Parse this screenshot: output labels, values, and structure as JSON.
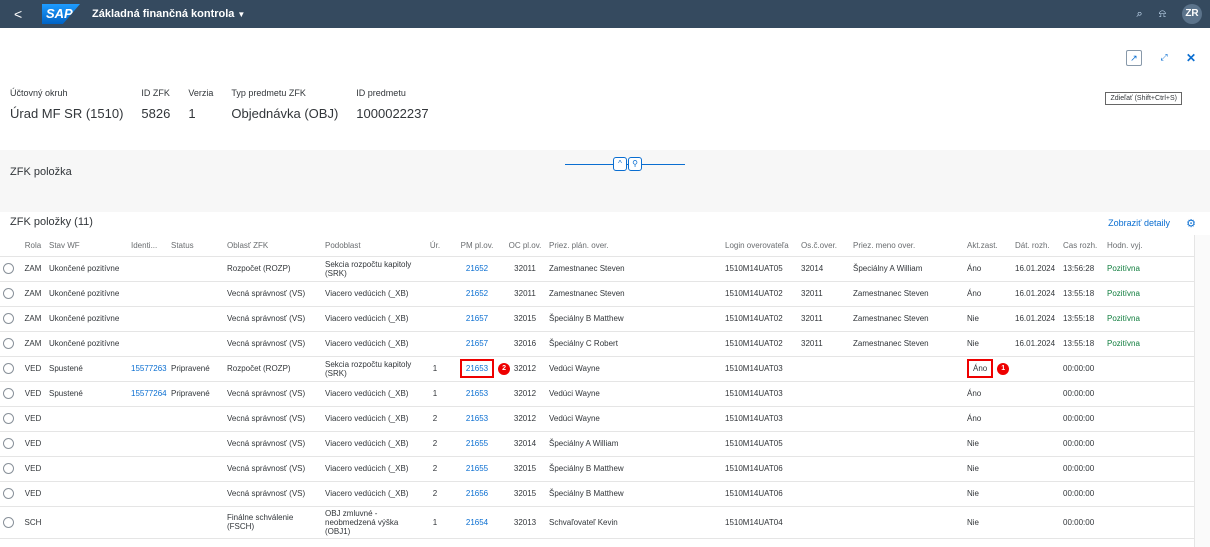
{
  "shell": {
    "back": "<",
    "logo": "SAP",
    "title": "Základná finančná kontrola",
    "avatar": "ZR"
  },
  "header": {
    "tooltip": "Zdieľať (Shift+Ctrl+S)",
    "fields": [
      {
        "label": "Účtovný okruh",
        "value": "Úrad MF SR (1510)"
      },
      {
        "label": "ID ZFK",
        "value": "5826"
      },
      {
        "label": "Verzia",
        "value": "1"
      },
      {
        "label": "Typ predmetu ZFK",
        "value": "Objednávka (OBJ)"
      },
      {
        "label": "ID predmetu",
        "value": "1000022237"
      }
    ]
  },
  "section_title": "ZFK položka",
  "table": {
    "title": "ZFK položky (11)",
    "details_link": "Zobraziť detaily",
    "columns": [
      "",
      "Rola",
      "Stav WF",
      "Identi...",
      "Status",
      "Oblasť ZFK",
      "Podoblast",
      "Úr.",
      "PM pl.ov.",
      "OC pl.ov.",
      "Priez. plán. over.",
      "Login overovateľa",
      "Os.č.over.",
      "Priez. meno over.",
      "Akt.zast.",
      "Dát. rozh.",
      "Cas rozh.",
      "Hodn. vyj."
    ],
    "rows": [
      [
        "",
        "ZAM",
        "Ukončené pozitívne",
        "",
        "",
        "Rozpočet (ROZP)",
        "Sekcia rozpočtu kapitoly (SRK)",
        "",
        "21652",
        "32011",
        "Zamestnanec Steven",
        "1510M14UAT05",
        "32014",
        "Špeciálny A William",
        "Áno",
        "16.01.2024",
        "13:56:28",
        "Pozitívna"
      ],
      [
        "",
        "ZAM",
        "Ukončené pozitívne",
        "",
        "",
        "Vecná správnosť (VS)",
        "Viacero vedúcich (_XB)",
        "",
        "21652",
        "32011",
        "Zamestnanec Steven",
        "1510M14UAT02",
        "32011",
        "Zamestnanec Steven",
        "Áno",
        "16.01.2024",
        "13:55:18",
        "Pozitívna"
      ],
      [
        "",
        "ZAM",
        "Ukončené pozitívne",
        "",
        "",
        "Vecná správnosť (VS)",
        "Viacero vedúcich (_XB)",
        "",
        "21657",
        "32015",
        "Špeciálny B Matthew",
        "1510M14UAT02",
        "32011",
        "Zamestnanec Steven",
        "Nie",
        "16.01.2024",
        "13:55:18",
        "Pozitívna"
      ],
      [
        "",
        "ZAM",
        "Ukončené pozitívne",
        "",
        "",
        "Vecná správnosť (VS)",
        "Viacero vedúcich (_XB)",
        "",
        "21657",
        "32016",
        "Špeciálny C Robert",
        "1510M14UAT02",
        "32011",
        "Zamestnanec Steven",
        "Nie",
        "16.01.2024",
        "13:55:18",
        "Pozitívna"
      ],
      [
        "",
        "VED",
        "Spustené",
        "15577263",
        "Pripravené",
        "Rozpočet (ROZP)",
        "Sekcia rozpočtu kapitoly (SRK)",
        "1",
        "21653",
        "32012",
        "Vedúci Wayne",
        "1510M14UAT03",
        "",
        "",
        "Áno",
        "",
        "00:00:00",
        ""
      ],
      [
        "",
        "VED",
        "Spustené",
        "15577264",
        "Pripravené",
        "Vecná správnosť (VS)",
        "Viacero vedúcich (_XB)",
        "1",
        "21653",
        "32012",
        "Vedúci Wayne",
        "1510M14UAT03",
        "",
        "",
        "Áno",
        "",
        "00:00:00",
        ""
      ],
      [
        "",
        "VED",
        "",
        "",
        "",
        "Vecná správnosť (VS)",
        "Viacero vedúcich (_XB)",
        "2",
        "21653",
        "32012",
        "Vedúci Wayne",
        "1510M14UAT03",
        "",
        "",
        "Áno",
        "",
        "00:00:00",
        ""
      ],
      [
        "",
        "VED",
        "",
        "",
        "",
        "Vecná správnosť (VS)",
        "Viacero vedúcich (_XB)",
        "2",
        "21655",
        "32014",
        "Špeciálny A William",
        "1510M14UAT05",
        "",
        "",
        "Nie",
        "",
        "00:00:00",
        ""
      ],
      [
        "",
        "VED",
        "",
        "",
        "",
        "Vecná správnosť (VS)",
        "Viacero vedúcich (_XB)",
        "2",
        "21655",
        "32015",
        "Špeciálny B Matthew",
        "1510M14UAT06",
        "",
        "",
        "Nie",
        "",
        "00:00:00",
        ""
      ],
      [
        "",
        "VED",
        "",
        "",
        "",
        "Vecná správnosť (VS)",
        "Viacero vedúcich (_XB)",
        "2",
        "21656",
        "32015",
        "Špeciálny B Matthew",
        "1510M14UAT06",
        "",
        "",
        "Nie",
        "",
        "00:00:00",
        ""
      ],
      [
        "",
        "SCH",
        "",
        "",
        "",
        "Finálne schválenie (FSCH)",
        "OBJ zmluvné - neobmedzená výška (OBJ1)",
        "1",
        "21654",
        "32013",
        "Schvaľovateľ Kevin",
        "1510M14UAT04",
        "",
        "",
        "Nie",
        "",
        "00:00:00",
        ""
      ]
    ],
    "highlight_badges": [
      "1",
      "2"
    ]
  },
  "colors": {
    "shell": "#354a5f",
    "link": "#0a6ed1",
    "positive": "#107e3e",
    "highlight": "#ee0000"
  }
}
